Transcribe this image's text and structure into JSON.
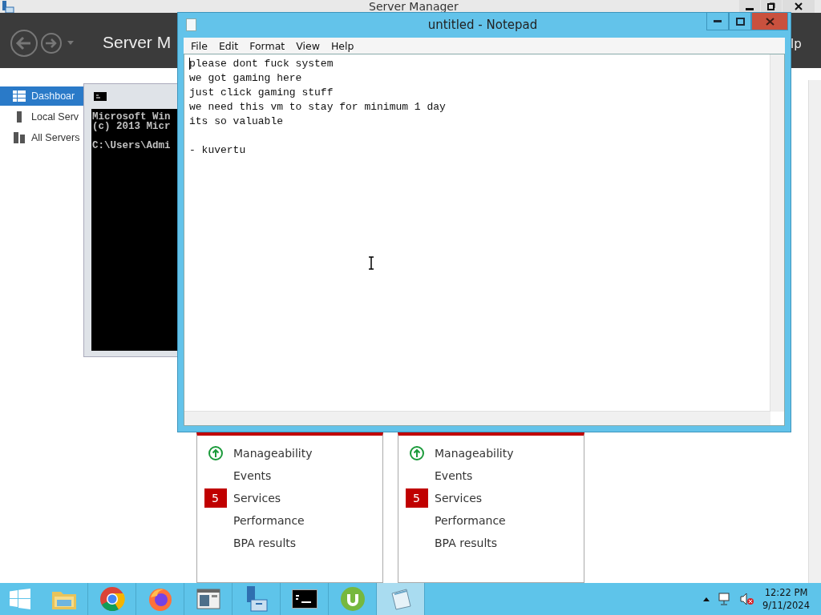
{
  "server_manager": {
    "title": "Server Manager",
    "header_title": "Server M",
    "header_right": "lp",
    "nav": [
      {
        "label": "Dashboar",
        "selected": true
      },
      {
        "label": "Local Serv",
        "selected": false
      },
      {
        "label": "All Servers",
        "selected": false
      }
    ],
    "tiles": [
      {
        "rows": [
          {
            "label": "Manageability",
            "kind": "ok"
          },
          {
            "label": "Events",
            "kind": "plain"
          },
          {
            "label": "Services",
            "kind": "count",
            "count": "5"
          },
          {
            "label": "Performance",
            "kind": "plain"
          },
          {
            "label": "BPA results",
            "kind": "plain"
          }
        ]
      },
      {
        "rows": [
          {
            "label": "Manageability",
            "kind": "ok"
          },
          {
            "label": "Events",
            "kind": "plain"
          },
          {
            "label": "Services",
            "kind": "count",
            "count": "5"
          },
          {
            "label": "Performance",
            "kind": "plain"
          },
          {
            "label": "BPA results",
            "kind": "plain"
          }
        ]
      }
    ]
  },
  "console": {
    "paragraphs": [
      [
        "Microsoft Win",
        "(c) 2013 Micr"
      ],
      [
        "C:\\Users\\Admi"
      ]
    ]
  },
  "notepad": {
    "title": "untitled - Notepad",
    "menu": [
      "File",
      "Edit",
      "Format",
      "View",
      "Help"
    ],
    "paragraphs": [
      [
        "please dont fuck system",
        "we got gaming here",
        "just click gaming stuff",
        "we need this vm to stay for minimum 1 day",
        "its so valuable"
      ],
      [
        "- kuvertu"
      ]
    ]
  },
  "taskbar": {
    "apps": [
      {
        "kind": "explorer",
        "active": false
      },
      {
        "kind": "chrome",
        "active": false
      },
      {
        "kind": "firefox",
        "active": false
      },
      {
        "kind": "window",
        "active": false
      },
      {
        "kind": "server",
        "active": false
      },
      {
        "kind": "console",
        "active": false
      },
      {
        "kind": "torrent",
        "active": false
      },
      {
        "kind": "notepad",
        "active": true
      }
    ],
    "time": "12:22 PM",
    "date": "9/11/2024"
  }
}
